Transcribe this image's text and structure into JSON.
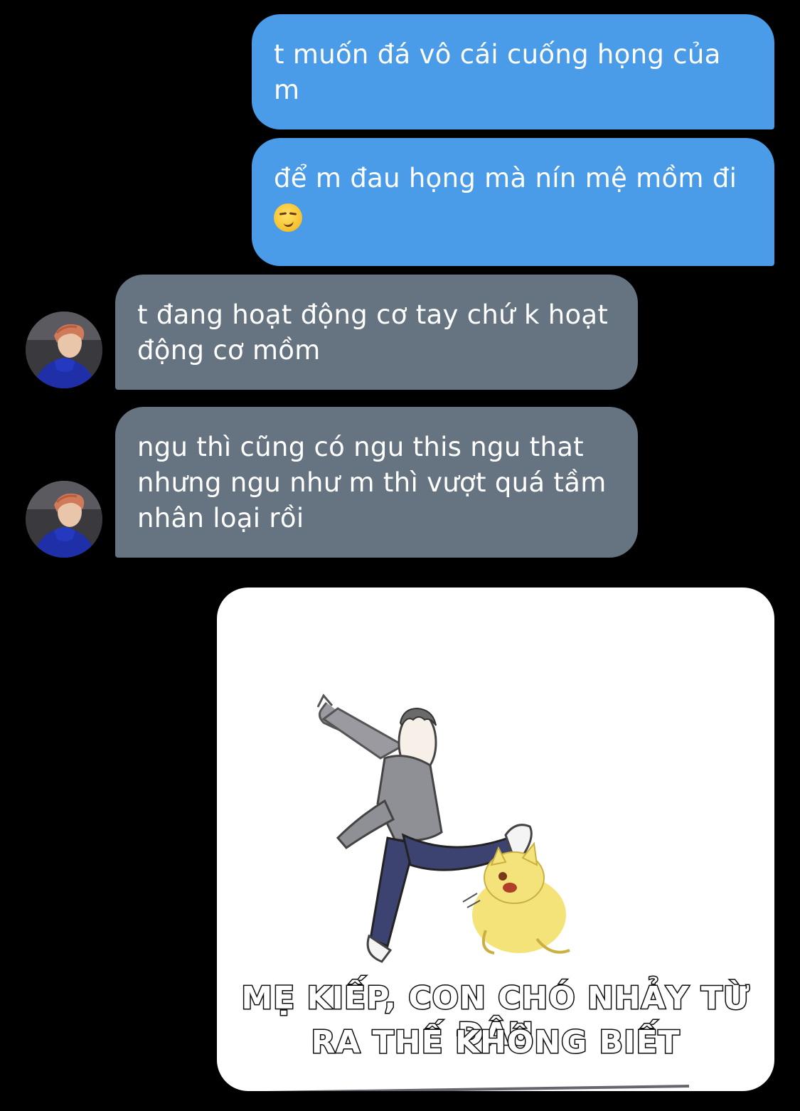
{
  "messages": [
    {
      "direction": "outgoing",
      "text": "t muốn đá vô cái cuống họng của m"
    },
    {
      "direction": "outgoing",
      "text": "để m đau họng mà nín mệ mồm đi",
      "emoji": "smirking-face-icon"
    },
    {
      "direction": "incoming",
      "text": "t đang hoạt động cơ tay chứ k hoạt động cơ mồm"
    },
    {
      "direction": "incoming",
      "text": "ngu thì cũng có ngu this ngu that nhưng ngu như m thì vượt quá tầm nhân loại rồi"
    }
  ],
  "meme": {
    "caption_line1": "MẸ KIẾP, CON CHÓ NHẢY TỪ ĐÂU",
    "caption_line2": "RA THẾ KHÔNG BIẾT"
  },
  "colors": {
    "outgoing_bubble": "#4A9BE8",
    "incoming_bubble": "#667380",
    "background": "#000000"
  }
}
